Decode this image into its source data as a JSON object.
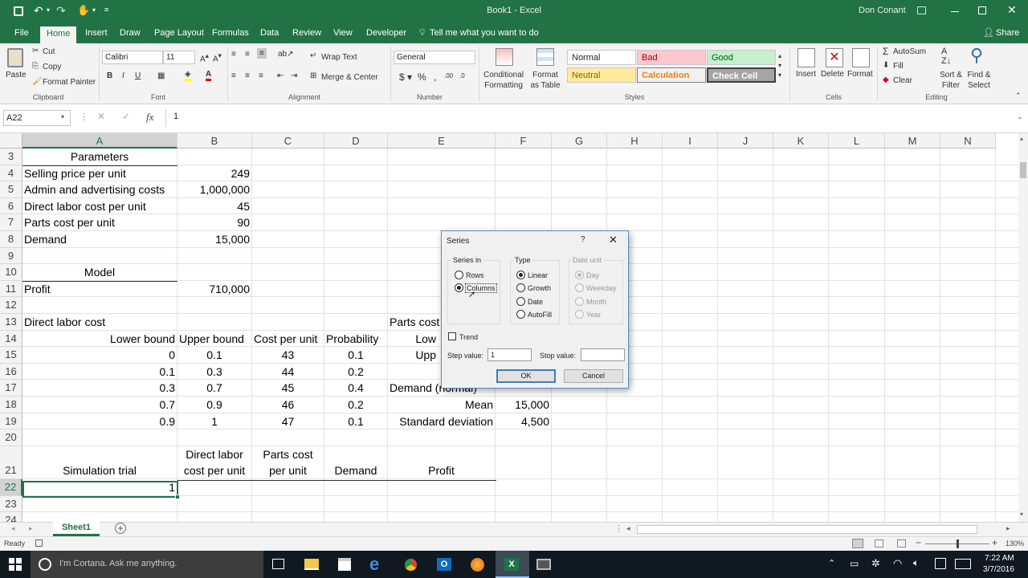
{
  "title_bar": {
    "title": "Book1 - Excel",
    "user": "Don Conant"
  },
  "tabs": [
    "File",
    "Home",
    "Insert",
    "Draw",
    "Page Layout",
    "Formulas",
    "Data",
    "Review",
    "View",
    "Developer"
  ],
  "tell_me": "Tell me what you want to do",
  "share": "Share",
  "ribbon": {
    "clipboard": {
      "paste": "Paste",
      "cut": "Cut",
      "copy": "Copy",
      "format_painter": "Format Painter",
      "label": "Clipboard"
    },
    "font": {
      "name": "Calibri",
      "size": "11",
      "label": "Font"
    },
    "alignment": {
      "wrap": "Wrap Text",
      "merge": "Merge & Center",
      "label": "Alignment"
    },
    "number": {
      "format": "General",
      "label": "Number"
    },
    "styles": {
      "cond": "Conditional Formatting",
      "format_table": "Format as Table",
      "normal": "Normal",
      "bad": "Bad",
      "good": "Good",
      "neutral": "Neutral",
      "calculation": "Calculation",
      "check": "Check Cell",
      "label": "Styles"
    },
    "cells": {
      "insert": "Insert",
      "delete": "Delete",
      "format": "Format",
      "label": "Cells"
    },
    "editing": {
      "autosum": "AutoSum",
      "fill": "Fill",
      "clear": "Clear",
      "sort": "Sort & Filter",
      "find": "Find & Select",
      "label": "Editing"
    }
  },
  "formula_bar": {
    "name_box": "A22",
    "fx": "fx",
    "value": "1"
  },
  "columns": [
    "A",
    "B",
    "C",
    "D",
    "E",
    "F",
    "G",
    "H",
    "I",
    "J",
    "K",
    "L",
    "M",
    "N"
  ],
  "rows": [
    "3",
    "4",
    "5",
    "6",
    "7",
    "8",
    "9",
    "10",
    "11",
    "12",
    "13",
    "14",
    "15",
    "16",
    "17",
    "18",
    "19",
    "20",
    "21",
    "22",
    "23",
    "24"
  ],
  "cells": {
    "A3": "Parameters",
    "A4": "Selling price per unit",
    "B4": "249",
    "A5": "Admin and advertising costs",
    "B5": "1,000,000",
    "A6": "Direct labor cost per unit",
    "B6": "45",
    "A7": "Parts cost per unit",
    "B7": "90",
    "A8": "Demand",
    "B8": "15,000",
    "A10": "Model",
    "A11": "Profit",
    "B11": "710,000",
    "A13": "Direct labor cost",
    "E13": "Parts cost",
    "A14": "Lower bound",
    "B14": "Upper bound",
    "C14": "Cost per unit",
    "D14": "Probability",
    "E14": "Low",
    "A15": "0",
    "B15": "0.1",
    "C15": "43",
    "D15": "0.1",
    "E15": "Upp",
    "A16": "0.1",
    "B16": "0.3",
    "C16": "44",
    "D16": "0.2",
    "A17": "0.3",
    "B17": "0.7",
    "C17": "45",
    "D17": "0.4",
    "E17": "Demand (normal)",
    "A18": "0.7",
    "B18": "0.9",
    "C18": "46",
    "D18": "0.2",
    "E18": "Mean",
    "F18": "15,000",
    "A19": "0.9",
    "B19": "1",
    "C19": "47",
    "D19": "0.1",
    "E19": "Standard deviation",
    "F19": "4,500",
    "A21": "Simulation trial",
    "B21a": "Direct labor",
    "B21b": "cost per unit",
    "C21a": "Parts cost",
    "C21b": "per unit",
    "D21": "Demand",
    "E21": "Profit",
    "A22": "1"
  },
  "dialog": {
    "title": "Series",
    "help": "?",
    "series_in": "Series in",
    "rows": "Rows",
    "columns": "Columns",
    "type": "Type",
    "linear": "Linear",
    "growth": "Growth",
    "date": "Date",
    "autofill": "AutoFill",
    "date_unit": "Date unit",
    "day": "Day",
    "weekday": "Weekday",
    "month": "Month",
    "year": "Year",
    "trend": "Trend",
    "step_label": "Step value:",
    "step_value": "1",
    "stop_label": "Stop value:",
    "stop_value": "",
    "ok": "OK",
    "cancel": "Cancel"
  },
  "sheet_tab": "Sheet1",
  "status": {
    "ready": "Ready",
    "zoom": "130%"
  },
  "taskbar": {
    "cortana": "I'm Cortana. Ask me anything.",
    "time": "7:22 AM",
    "date": "3/7/2016"
  },
  "colors": {
    "excel_green": "#217346",
    "bad_bg": "#ffc7ce",
    "good_bg": "#c6efce",
    "neutral_bg": "#ffeb9c",
    "check_bg": "#a5a5a5",
    "calc_color": "#fa7d00"
  }
}
